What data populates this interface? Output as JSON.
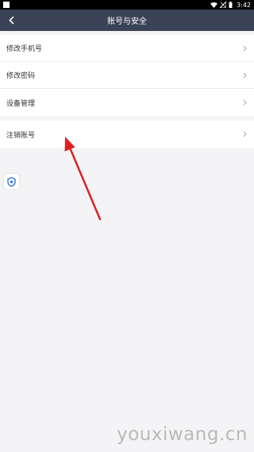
{
  "status_bar": {
    "time": "3:42"
  },
  "nav": {
    "title": "账号与安全",
    "back_icon": "chevron-left-icon"
  },
  "settings": {
    "group1": [
      {
        "label": "修改手机号"
      },
      {
        "label": "修改密码"
      },
      {
        "label": "设备管理"
      }
    ],
    "group2": [
      {
        "label": "注销账号"
      }
    ]
  },
  "floating": {
    "icon": "shield-icon"
  },
  "annotation": {
    "color": "#e02020"
  },
  "watermark": "youxiwang.cn"
}
